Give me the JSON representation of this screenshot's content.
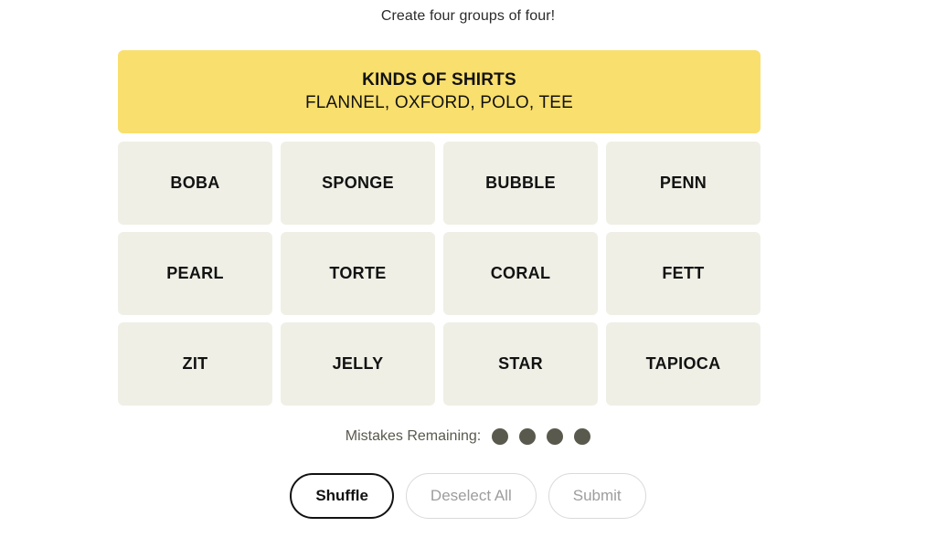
{
  "instruction": "Create four groups of four!",
  "colors": {
    "solved_yellow": "#f9df6d",
    "tile_bg": "#efefe6",
    "text_dark": "#121212",
    "dot": "#5a594e",
    "disabled_text": "#9d9d9d",
    "disabled_border": "#d9d9d9"
  },
  "solved_groups": [
    {
      "title": "KINDS OF SHIRTS",
      "words_text": "FLANNEL, OXFORD, POLO, TEE",
      "words": [
        "FLANNEL",
        "OXFORD",
        "POLO",
        "TEE"
      ],
      "color": "#f9df6d"
    }
  ],
  "grid": {
    "rows": [
      [
        "BOBA",
        "SPONGE",
        "BUBBLE",
        "PENN"
      ],
      [
        "PEARL",
        "TORTE",
        "CORAL",
        "FETT"
      ],
      [
        "ZIT",
        "JELLY",
        "STAR",
        "TAPIOCA"
      ]
    ]
  },
  "mistakes": {
    "label": "Mistakes Remaining:",
    "remaining": 4,
    "dots": [
      "dot-1",
      "dot-2",
      "dot-3",
      "dot-4"
    ]
  },
  "controls": {
    "shuffle_label": "Shuffle",
    "deselect_label": "Deselect All",
    "submit_label": "Submit",
    "shuffle_enabled": true,
    "deselect_enabled": false,
    "submit_enabled": false
  }
}
